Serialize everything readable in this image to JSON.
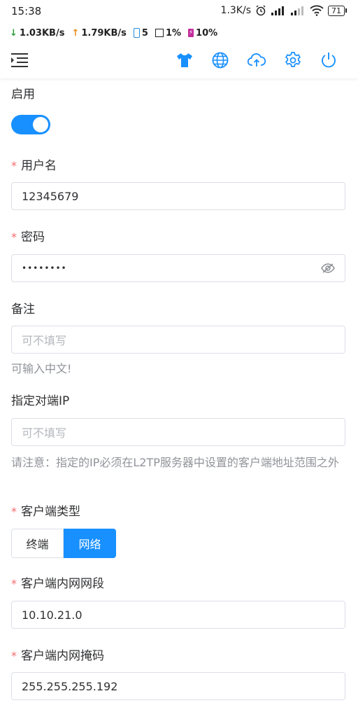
{
  "status_bar": {
    "time": "15:38",
    "net_speed": "1.3K/s",
    "battery": "71"
  },
  "net_monitor": {
    "download": "1.03KB/s",
    "upload": "1.79KB/s",
    "phone_count": "5",
    "cpu": "1%",
    "battery_pct": "10%"
  },
  "toolbar": {
    "icons": [
      "menu-icon",
      "tshirt-icon",
      "globe-icon",
      "cloud-upload-icon",
      "gear-icon",
      "power-icon"
    ],
    "accent": "#1890ff"
  },
  "form": {
    "enable_label": "启用",
    "enabled": true,
    "username_label": "用户名",
    "username_value": "12345679",
    "password_label": "密码",
    "password_value": "••••••••",
    "remark_label": "备注",
    "remark_placeholder": "可不填写",
    "remark_hint": "可输入中文!",
    "peer_ip_label": "指定对端IP",
    "peer_ip_placeholder": "可不填写",
    "peer_ip_hint": "请注意：指定的IP必须在L2TP服务器中设置的客户端地址范围之外",
    "client_type_label": "客户端类型",
    "client_type_options": [
      "终端",
      "网络"
    ],
    "client_type_selected": "网络",
    "subnet_label": "客户端内网网段",
    "subnet_value": "10.10.21.0",
    "mask_label": "客户端内网掩码",
    "mask_value": "255.255.255.192",
    "required_mark": "*"
  }
}
